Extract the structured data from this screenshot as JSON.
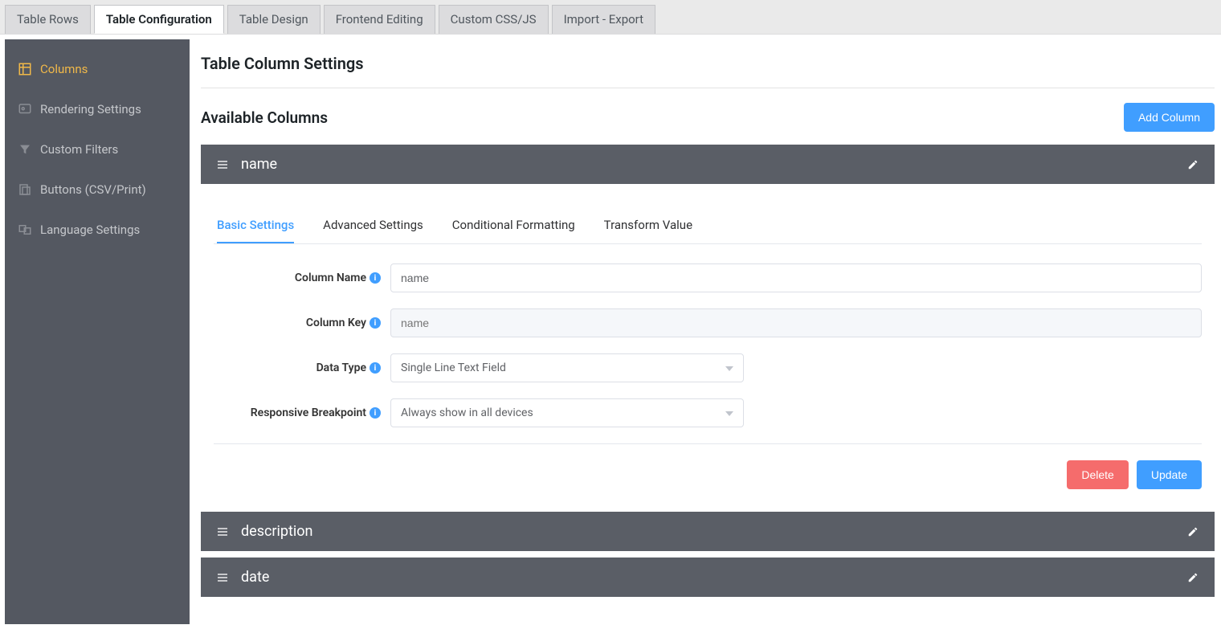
{
  "top_tabs": {
    "table_rows": "Table Rows",
    "table_configuration": "Table Configuration",
    "table_design": "Table Design",
    "frontend_editing": "Frontend Editing",
    "custom_css_js": "Custom CSS/JS",
    "import_export": "Import - Export"
  },
  "sidebar": {
    "columns": "Columns",
    "rendering_settings": "Rendering Settings",
    "custom_filters": "Custom Filters",
    "buttons": "Buttons (CSV/Print)",
    "language_settings": "Language Settings"
  },
  "page": {
    "title": "Table Column Settings",
    "available_columns": "Available Columns",
    "add_column_button": "Add Column"
  },
  "expanded_column": {
    "name": "name",
    "sub_tabs": {
      "basic": "Basic Settings",
      "advanced": "Advanced Settings",
      "conditional": "Conditional Formatting",
      "transform": "Transform Value"
    },
    "labels": {
      "column_name": "Column Name",
      "column_key": "Column Key",
      "data_type": "Data Type",
      "responsive_breakpoint": "Responsive Breakpoint"
    },
    "values": {
      "column_name": "name",
      "column_key_placeholder": "name",
      "data_type": "Single Line Text Field",
      "responsive_breakpoint": "Always show in all devices"
    },
    "buttons": {
      "delete": "Delete",
      "update": "Update"
    }
  },
  "collapsed_columns": {
    "description": "description",
    "date": "date"
  }
}
